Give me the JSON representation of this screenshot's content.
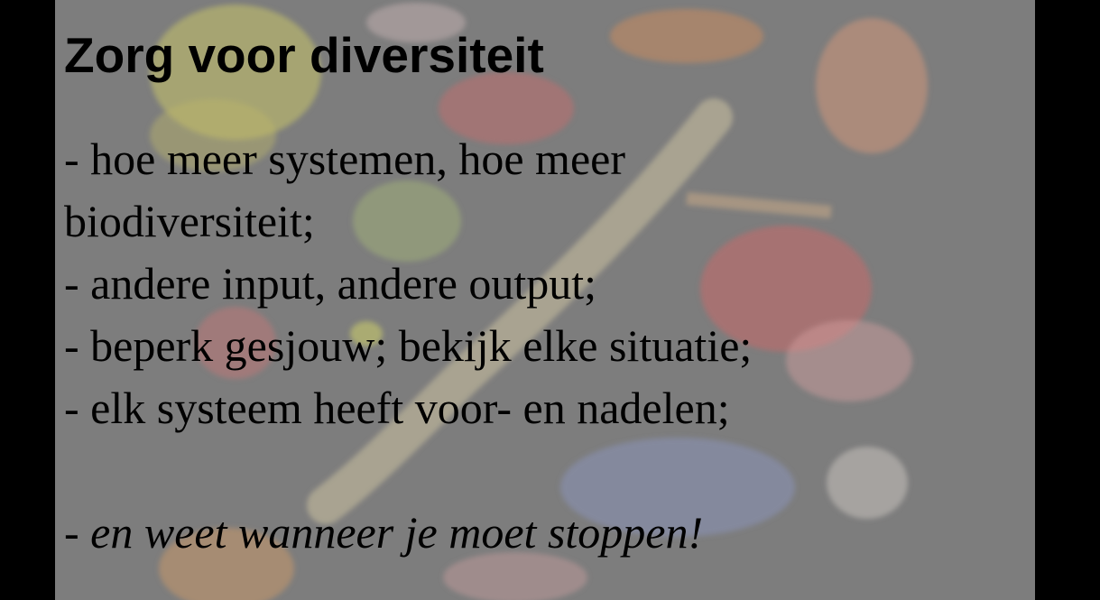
{
  "slide": {
    "title": "Zorg voor diversiteit",
    "bullets": [
      "- hoe meer systemen, hoe meer",
      "biodiversiteit;",
      "- andere input, andere output;",
      "- beperk gesjouw; bekijk elke situatie;",
      "- elk systeem heeft voor- en nadelen;"
    ],
    "closing_prefix": "- ",
    "closing_emphasis": "en weet wanneer je moet stoppen!"
  },
  "colors": {
    "slide_background": "#7d7d7d",
    "letterbox": "#000000",
    "text": "#000000"
  }
}
